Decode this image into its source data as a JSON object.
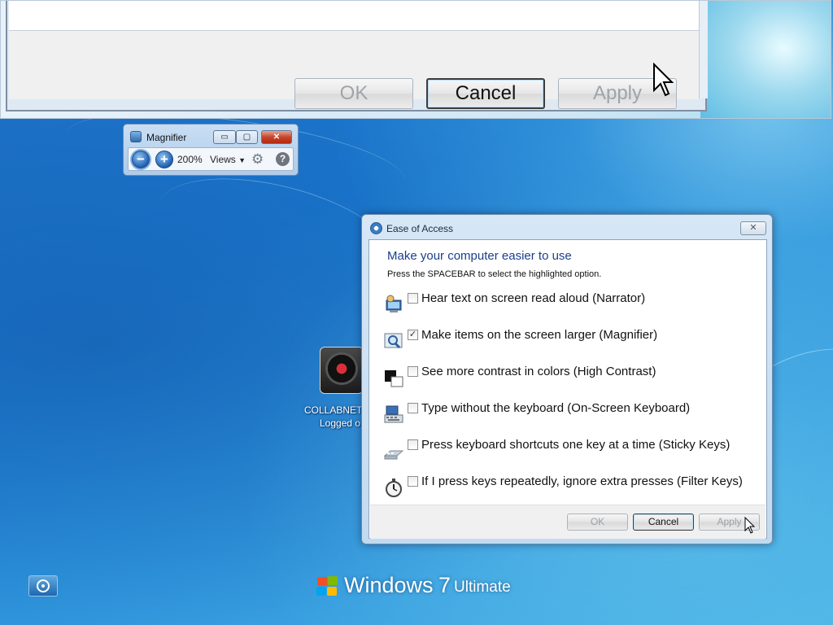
{
  "zoomed": {
    "ok_label": "OK",
    "cancel_label": "Cancel",
    "apply_label": "Apply"
  },
  "magnifier": {
    "title": "Magnifier",
    "zoom_level": "200%",
    "views_label": "Views",
    "minimize_symbol": "▭",
    "maximize_symbol": "▢",
    "close_symbol": "✕",
    "zoom_out_symbol": "−",
    "zoom_in_symbol": "+",
    "help_symbol": "?"
  },
  "desktop_icon": {
    "line1": "COLLABNETV",
    "line2": "Logged o"
  },
  "ease_dialog": {
    "title": "Ease of Access",
    "close_symbol": "✕",
    "heading": "Make your computer easier to use",
    "instruction": "Press the SPACEBAR to select the highlighted option.",
    "options": [
      {
        "label": "Hear text on screen read aloud (Narrator)",
        "checked": false,
        "icon": "narrator-icon"
      },
      {
        "label": "Make items on the screen larger (Magnifier)",
        "checked": true,
        "icon": "magnifier-icon"
      },
      {
        "label": "See more contrast in colors (High Contrast)",
        "checked": false,
        "icon": "high-contrast-icon"
      },
      {
        "label": "Type without the keyboard (On-Screen Keyboard)",
        "checked": false,
        "icon": "keyboard-icon"
      },
      {
        "label": "Press keyboard shortcuts one key at a time (Sticky Keys)",
        "checked": false,
        "icon": "sticky-keys-icon"
      },
      {
        "label": "If I press keys repeatedly, ignore extra presses (Filter Keys)",
        "checked": false,
        "icon": "stopwatch-icon"
      }
    ],
    "ok_label": "OK",
    "cancel_label": "Cancel",
    "apply_label": "Apply",
    "check_symbol": "✓"
  },
  "branding": {
    "windows": "Windows",
    "version": "7",
    "edition": "Ultimate"
  },
  "colors": {
    "heading_blue": "#1a3e8c",
    "disabled_text": "#9ba0a5",
    "close_red": "#c7442a"
  }
}
